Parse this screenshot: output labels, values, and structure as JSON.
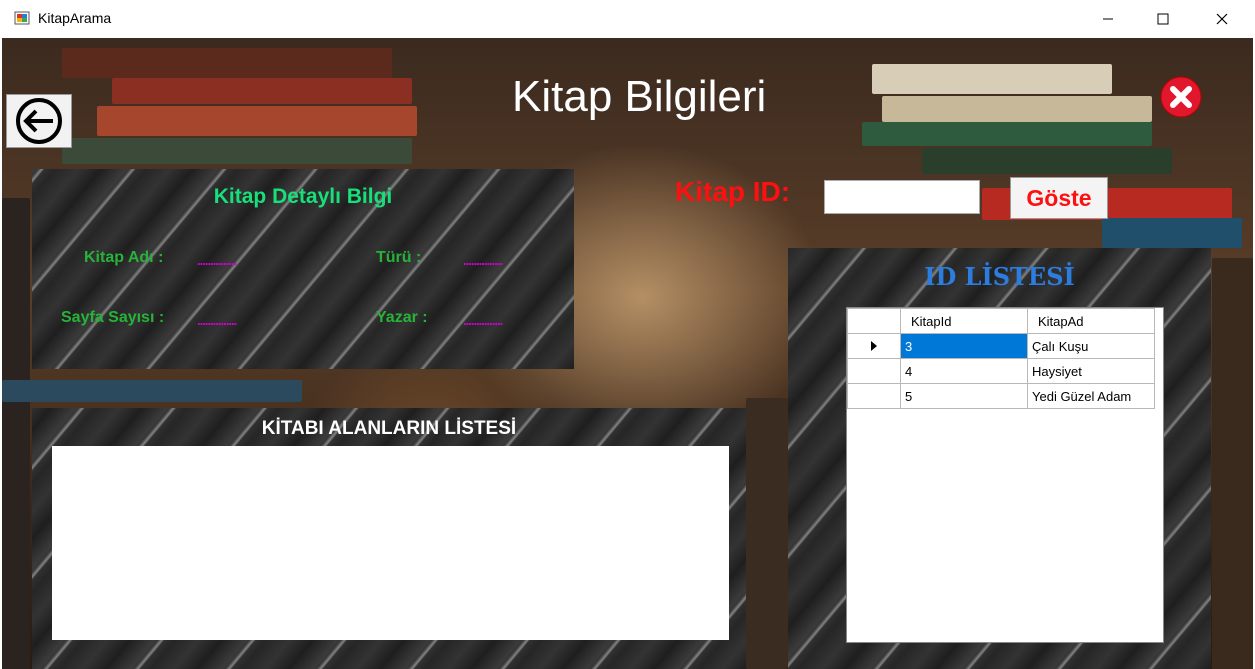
{
  "window": {
    "title": "KitapArama"
  },
  "header": {
    "title": "Kitap Bilgileri"
  },
  "detail": {
    "title": "Kitap Detaylı Bilgi",
    "kitap_adi_label": "Kitap Adı :",
    "kitap_adi_value": "...............",
    "turu_label": "Türü :",
    "turu_value": "...............",
    "sayfa_sayisi_label": "Sayfa Sayısı :",
    "sayfa_sayisi_value": "...............",
    "yazar_label": "Yazar :",
    "yazar_value": "..............."
  },
  "search": {
    "label": "Kitap ID:",
    "value": "",
    "button_label": "Göste"
  },
  "borrowers": {
    "title": "KİTABI ALANLARIN LİSTESİ"
  },
  "id_list": {
    "title": "ID LİSTESİ",
    "columns": [
      "KitapId",
      "KitapAd"
    ],
    "rows": [
      {
        "id": "3",
        "name": "Çalı Kuşu",
        "selected": true
      },
      {
        "id": "4",
        "name": "Haysiyet",
        "selected": false
      },
      {
        "id": "5",
        "name": "Yedi Güzel Adam",
        "selected": false
      }
    ]
  },
  "icons": {
    "back": "back-arrow-icon",
    "exit": "close-circle-icon"
  },
  "colors": {
    "detail_title": "#17e07a",
    "label_green": "#27b33a",
    "placeholder_magenta": "#d000d0",
    "search_red": "#ff1010",
    "id_title_blue": "#2b7de0",
    "selection_blue": "#0078d7"
  }
}
